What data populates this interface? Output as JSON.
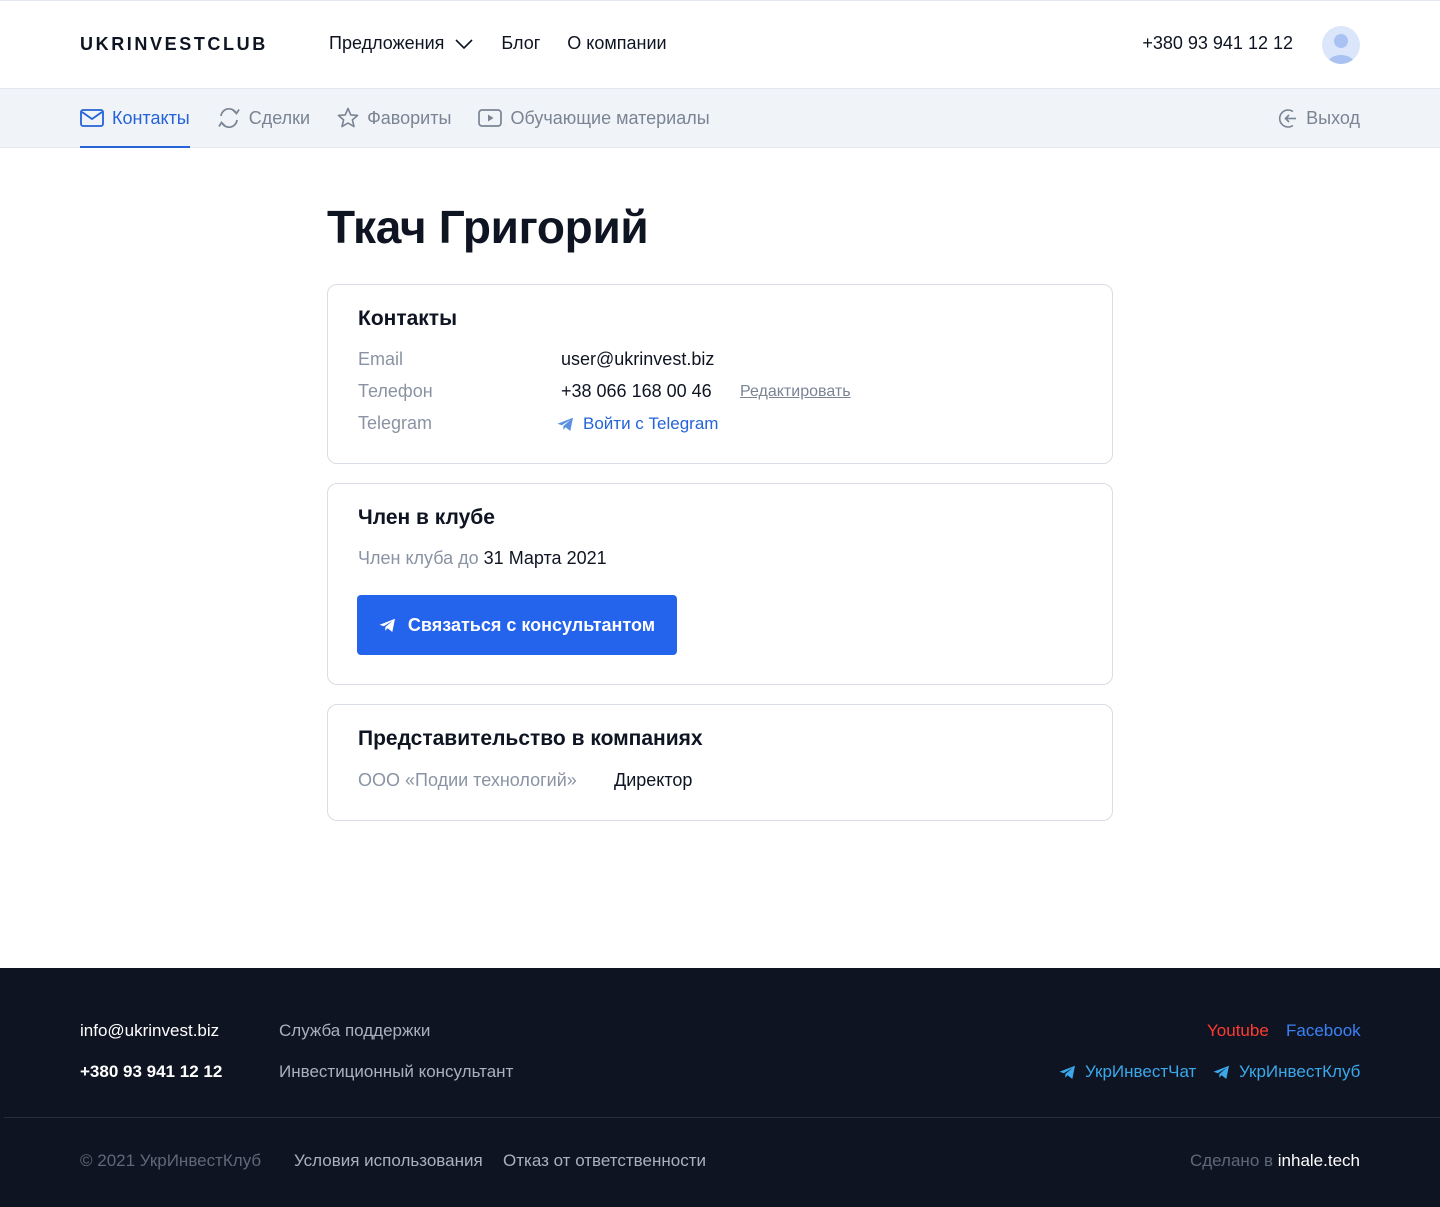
{
  "header": {
    "logo": "UKRINVESTCLUB",
    "nav": [
      {
        "label": "Предложения"
      },
      {
        "label": "Блог"
      },
      {
        "label": "О компании"
      }
    ],
    "phone": "+380 93 941 12 12"
  },
  "subnav": {
    "tabs": [
      {
        "label": "Контакты",
        "icon": "mail-icon"
      },
      {
        "label": "Сделки",
        "icon": "refresh-icon"
      },
      {
        "label": "Фавориты",
        "icon": "star-icon"
      },
      {
        "label": "Обучающие материалы",
        "icon": "video-icon"
      }
    ],
    "logout": "Выход"
  },
  "profile": {
    "name": "Ткач Григорий"
  },
  "contacts": {
    "title": "Контакты",
    "email_label": "Email",
    "email_value": "user@ukrinvest.biz",
    "phone_label": "Телефон",
    "phone_value": "+38 066 168 00 46",
    "edit_label": "Редактировать",
    "telegram_label": "Telegram",
    "telegram_link": "Войти с Telegram"
  },
  "membership": {
    "title": "Член в клубе",
    "until_label": "Член клуба до",
    "until_value": "31 Марта 2021",
    "cta_label": "Связаться с консультантом"
  },
  "representation": {
    "title": "Представительство в компаниях",
    "company": "ООО «Подии технологий»",
    "role": "Директор"
  },
  "footer": {
    "email": "info@ukrinvest.biz",
    "phone": "+380 93 941 12 12",
    "support": "Служба поддержки",
    "consultant": "Инвестиционный консультант",
    "youtube": "Youtube",
    "facebook": "Facebook",
    "chat": "УкрИнвестЧат",
    "club": "УкрИнвестКлуб",
    "copyright": "© 2021 УкрИнвестКлуб",
    "terms": "Условия использования",
    "disclaimer": "Отказ от ответственности",
    "made_by_prefix": "Сделано в",
    "made_by": "inhale.tech"
  },
  "colors": {
    "accent": "#2463eb",
    "youtube": "#ff3b30",
    "facebook": "#3b82f6",
    "telegram": "#3ba8ea",
    "footer_bg": "#0e1422"
  }
}
